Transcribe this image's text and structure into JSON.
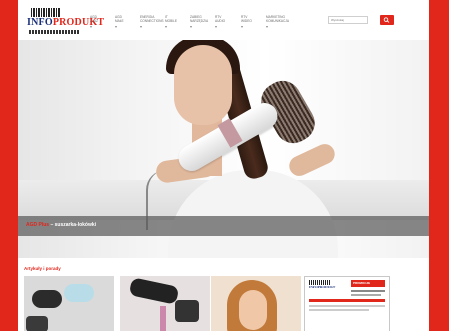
{
  "header": {
    "logo_text_a": "INFO",
    "logo_text_b": "PRODUKT",
    "nav": [
      {
        "line1": "AGD",
        "line2": "ZLUŻ"
      },
      {
        "line1": "AGD",
        "line2": "MAŁE"
      },
      {
        "line1": "ENERGIA",
        "line2": "CONNECTIONS"
      },
      {
        "line1": "IT",
        "line2": "MOBILE"
      },
      {
        "line1": "ZABIEG",
        "line2": "NARZĘDZIA"
      },
      {
        "line1": "RTV",
        "line2": "AUDIO"
      },
      {
        "line1": "RTV",
        "line2": "WIDEO"
      },
      {
        "line1": "MARKETING",
        "line2": "KOMUNIKACJA"
      }
    ],
    "search_placeholder": "Wyszukaj"
  },
  "hero": {
    "caption_brand": "AGD Plus",
    "caption_text": " – suszarka-lokówki"
  },
  "articles": {
    "title": "Artykuły i porady"
  },
  "magazine": {
    "logo": "INFOPRODUKT",
    "badge": "PROMOCJE"
  },
  "colors": {
    "brand_red": "#e1261c",
    "brand_blue": "#1a2f7a"
  }
}
